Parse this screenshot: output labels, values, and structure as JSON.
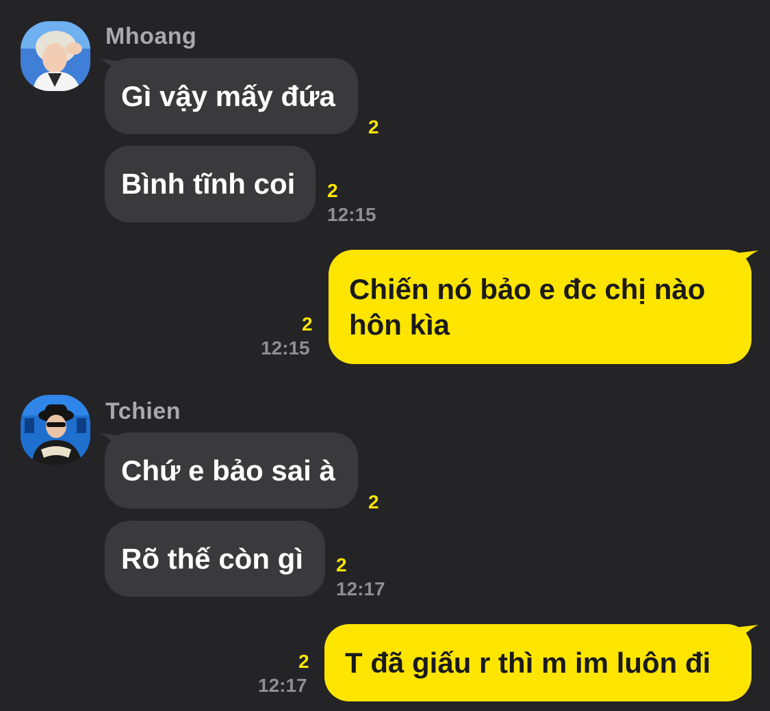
{
  "colors": {
    "background": "#242426",
    "incoming_bubble": "#3a3a3d",
    "outgoing_bubble": "#fee500",
    "unread_count": "#fee500",
    "timestamp": "#8e8e93",
    "sender_name": "#a9a9ad"
  },
  "messages": {
    "group1": {
      "sender": "Mhoang",
      "avatar_icon": "user-avatar-photo",
      "msg1": {
        "text": "Gì vậy mấy đứa",
        "unread": "2"
      },
      "msg2": {
        "text": "Bình tĩnh coi",
        "unread": "2",
        "time": "12:15"
      }
    },
    "out1": {
      "line1": "Chiến nó bảo e đc chị nào",
      "line2": "hôn kìa",
      "unread": "2",
      "time": "12:15"
    },
    "group2": {
      "sender": "Tchien",
      "avatar_icon": "user-avatar-photo",
      "msg1": {
        "text": "Chứ e bảo sai à",
        "unread": "2"
      },
      "msg2": {
        "text": "Rõ thế còn gì",
        "unread": "2",
        "time": "12:17"
      }
    },
    "out2": {
      "text": "T đã giấu r thì m im luôn đi",
      "unread": "2",
      "time": "12:17"
    }
  }
}
